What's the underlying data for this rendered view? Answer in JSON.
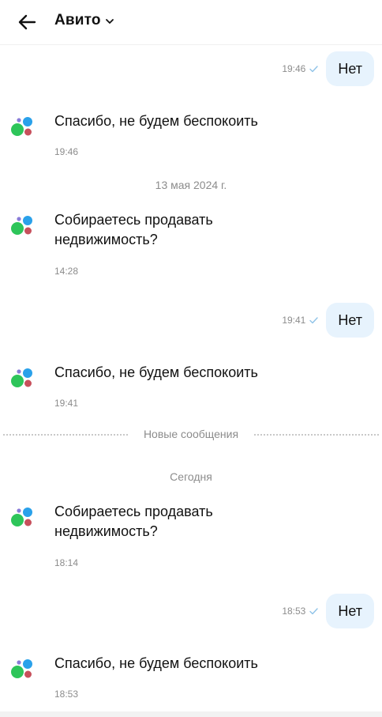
{
  "header": {
    "title": "Авито"
  },
  "date_separators": {
    "may": "13 мая 2024 г.",
    "new_messages": "Новые сообщения",
    "today": "Сегодня"
  },
  "messages": [
    {
      "direction": "out",
      "text": "Нет",
      "time": "19:46",
      "status": "read"
    },
    {
      "direction": "in",
      "text": "Спасибо, не будем беспокоить",
      "time": "19:46"
    },
    {
      "direction": "in",
      "text": "Собираетесь продавать недвижимость?",
      "time": "14:28"
    },
    {
      "direction": "out",
      "text": "Нет",
      "time": "19:41",
      "status": "read"
    },
    {
      "direction": "in",
      "text": "Спасибо, не будем беспокоить",
      "time": "19:41"
    },
    {
      "direction": "in",
      "text": "Собираетесь продавать недвижимость?",
      "time": "18:14"
    },
    {
      "direction": "out",
      "text": "Нет",
      "time": "18:53",
      "status": "read"
    },
    {
      "direction": "in",
      "text": "Спасибо, не будем беспокоить",
      "time": "18:53"
    }
  ],
  "colors": {
    "bubble_out": "#e7f3fd",
    "avatar_green": "#2ec55a",
    "avatar_blue": "#2aa1ea",
    "avatar_red": "#c7505c",
    "avatar_purple": "#8a7cd8",
    "check": "#8fc3e8"
  }
}
